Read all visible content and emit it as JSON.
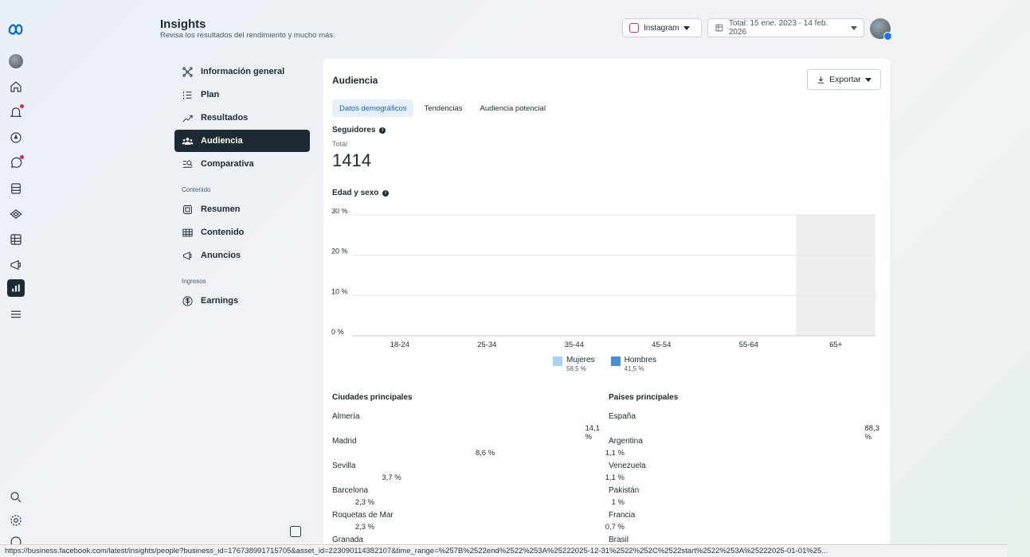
{
  "header": {
    "title": "Insights",
    "subtitle": "Revisa los resultados del rendimiento y mucho más.",
    "platform": "Instagram",
    "date_range": "Total: 15 ene. 2023 - 14 feb. 2026"
  },
  "nav": {
    "items": [
      {
        "label": "Información general",
        "icon": "nodes-icon"
      },
      {
        "label": "Plan",
        "icon": "list-icon"
      },
      {
        "label": "Resultados",
        "icon": "trend-icon"
      },
      {
        "label": "Audiencia",
        "icon": "people-icon",
        "active": true
      },
      {
        "label": "Comparativa",
        "icon": "compare-icon"
      }
    ],
    "section_content": "Contenido",
    "content_items": [
      {
        "label": "Resumen",
        "icon": "summary-icon"
      },
      {
        "label": "Contenido",
        "icon": "table-icon"
      },
      {
        "label": "Anuncios",
        "icon": "megaphone-icon"
      }
    ],
    "section_income": "Ingresos",
    "income_items": [
      {
        "label": "Earnings",
        "icon": "dollar-icon"
      }
    ]
  },
  "card": {
    "title": "Audiencia",
    "export_label": "Exportar",
    "tabs": [
      "Datos demográficos",
      "Tendencias",
      "Audiencia potencial"
    ],
    "followers_label": "Seguidores",
    "total_label": "Total",
    "followers_total": "1414",
    "age_sex_label": "Edad y sexo"
  },
  "chart_data": {
    "type": "bar",
    "title": "Edad y sexo",
    "categories": [
      "18-24",
      "25-34",
      "35-44",
      "45-54",
      "55-64",
      "65+"
    ],
    "y_ticks": [
      "0 %",
      "10 %",
      "20 %",
      "30 %"
    ],
    "ylim": [
      0,
      30
    ],
    "series": [
      {
        "name": "Mujeres",
        "share": "58,5 %",
        "color": "#a8d1f2",
        "values": [
          0,
          0,
          0,
          0,
          0,
          0
        ]
      },
      {
        "name": "Hombres",
        "share": "41,5 %",
        "color": "#4a90d9",
        "values": [
          0,
          0,
          0,
          0,
          0,
          0
        ]
      }
    ],
    "highlighted_category": "65+"
  },
  "cities": {
    "heading": "Ciudades principales",
    "rows": [
      {
        "name": "Almería",
        "pct": "14,1 %",
        "value": 14.1
      },
      {
        "name": "Madrid",
        "pct": "8,6 %",
        "value": 8.6
      },
      {
        "name": "Sevilla",
        "pct": "3,7 %",
        "value": 3.7
      },
      {
        "name": "Barcelona",
        "pct": "2,3 %",
        "value": 2.3
      },
      {
        "name": "Roquetas de Mar",
        "pct": "2,3 %",
        "value": 2.3
      },
      {
        "name": "Granada",
        "pct": "",
        "value": null
      }
    ]
  },
  "countries": {
    "heading": "Países principales",
    "rows": [
      {
        "name": "España",
        "pct": "88,3 %",
        "value": 88.3
      },
      {
        "name": "Argentina",
        "pct": "1,1 %",
        "value": 1.1
      },
      {
        "name": "Venezuela",
        "pct": "1,1 %",
        "value": 1.1
      },
      {
        "name": "Pakistán",
        "pct": "1 %",
        "value": 1
      },
      {
        "name": "Francia",
        "pct": "0,7 %",
        "value": 0.7
      },
      {
        "name": "Brasil",
        "pct": "",
        "value": null
      }
    ]
  },
  "status_url": "https://business.facebook.com/latest/insights/people?business_id=176738991715705&asset_id=223090114382107&time_range=%257B%2522end%2522%253A%25222025-12-31%2522%252C%2522start%2522%253A%25222025-01-01%25..."
}
